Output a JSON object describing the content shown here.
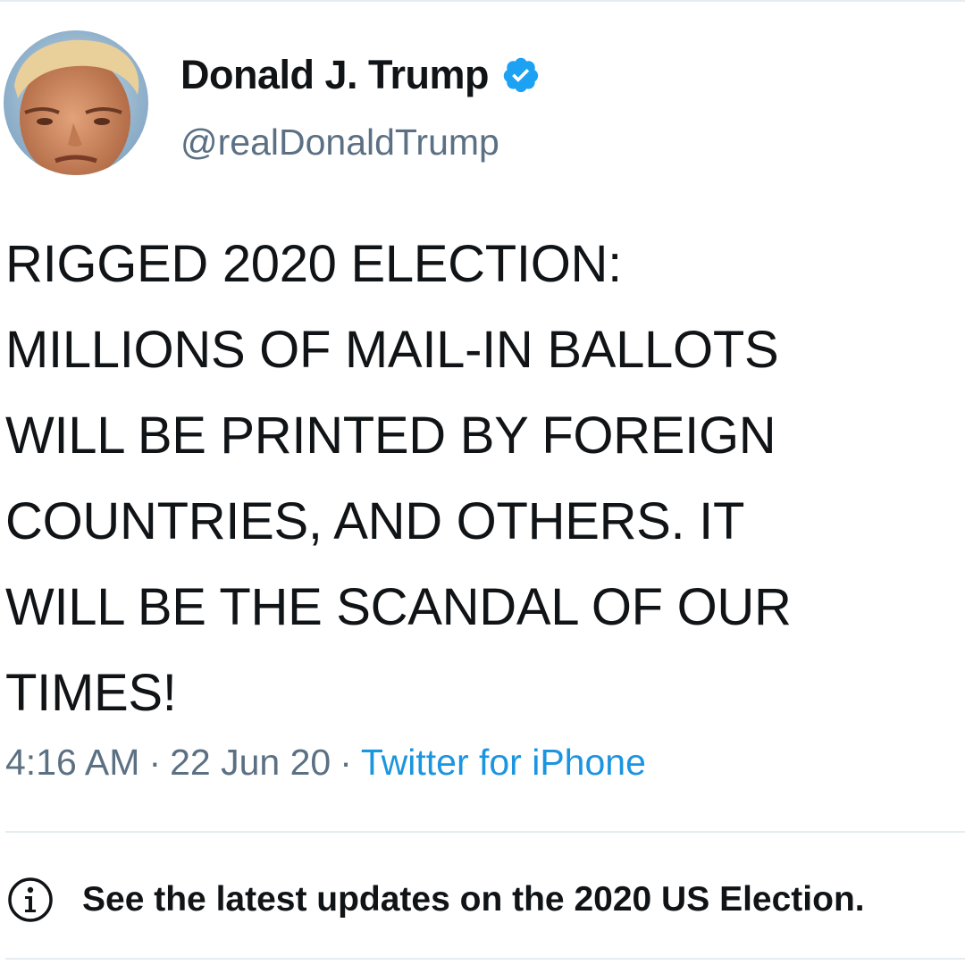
{
  "author": {
    "display_name": "Donald J. Trump",
    "handle": "@realDonaldTrump",
    "avatar_icon": "profile-photo",
    "verified_icon": "verified-badge-icon",
    "verified_color": "#1da1f2"
  },
  "tweet": {
    "lines": [
      "RIGGED 2020 ELECTION:",
      "MILLIONS OF MAIL-IN BALLOTS",
      "WILL BE PRINTED BY FOREIGN",
      "COUNTRIES, AND OTHERS. IT",
      "WILL BE THE SCANDAL OF OUR",
      "TIMES!"
    ]
  },
  "meta": {
    "time": "4:16 AM",
    "separator": "·",
    "date": "22 Jun 20",
    "source": "Twitter for iPhone",
    "muted_color": "#5b7083",
    "link_color": "#1b95e0"
  },
  "notice": {
    "icon": "info-icon",
    "text": "See the latest updates on the 2020 US Election."
  }
}
